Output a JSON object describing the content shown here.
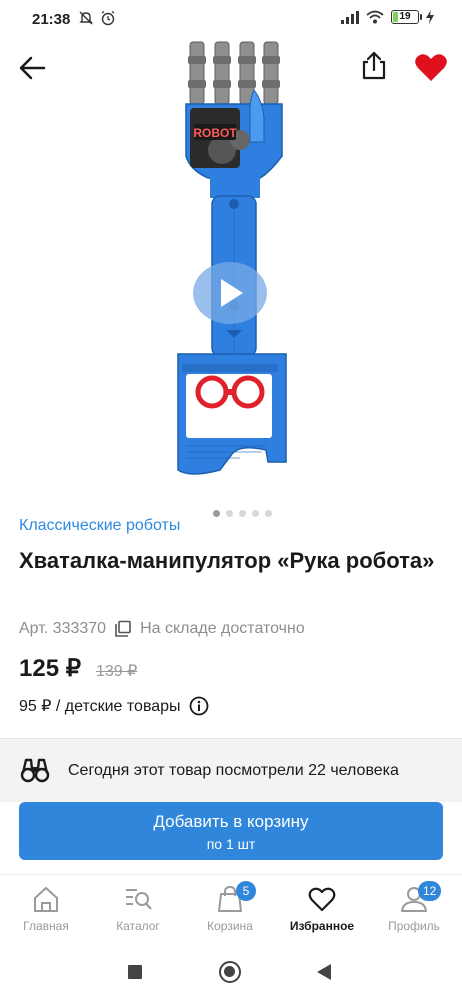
{
  "status_bar": {
    "time": "21:38",
    "battery": "19"
  },
  "product": {
    "category": "Классические роботы",
    "title": "Хваталка-манипулятор «Рука робота»",
    "article": "Арт. 333370",
    "stock": "На складе достаточно",
    "price": "125 ₽",
    "old_price": "139 ₽",
    "unit_price": "95 ₽ / детские товары",
    "image_text": "ROBOT",
    "gallery_count": 5,
    "gallery_active_index": 0
  },
  "views_banner": {
    "text": "Сегодня этот товар посмотрели 22 человека"
  },
  "cart_button": {
    "title": "Добавить в корзину",
    "subtitle": "по 1 шт"
  },
  "tabs": [
    {
      "label": "Главная",
      "icon": "home-icon"
    },
    {
      "label": "Каталог",
      "icon": "catalog-search-icon"
    },
    {
      "label": "Корзина",
      "icon": "shopping-bag-icon",
      "badge": "5"
    },
    {
      "label": "Избранное",
      "icon": "heart-icon",
      "active": true
    },
    {
      "label": "Профиль",
      "icon": "user-icon",
      "badge": "12"
    }
  ],
  "colors": {
    "accent": "#2f86da",
    "favorite": "#e0101f",
    "product_blue": "#2e7fe0"
  }
}
